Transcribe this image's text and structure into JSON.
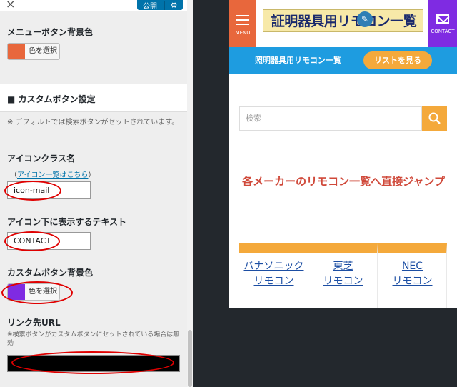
{
  "customizer": {
    "close_label": "×",
    "publish_label": "公開",
    "publish_gear": "⚙",
    "menu_bg_label": "メニューボタン背景色",
    "menu_bg_button": "色を選択",
    "menu_bg_color": "#e8673c",
    "section_title": "■ カスタムボタン設定",
    "section_note": "※ デフォルトでは検索ボタンがセットされています。",
    "icon_class_label": "アイコンクラス名",
    "icon_list_link": "アイコン一覧はこちら",
    "icon_class_value": "icon-mail",
    "icon_text_label": "アイコン下に表示するテキスト",
    "icon_text_value": "CONTACT",
    "custom_bg_label": "カスタムボタン背景色",
    "custom_bg_button": "色を選択",
    "custom_bg_color": "#7f2be2",
    "link_url_label": "リンク先URL",
    "link_url_note": "※検索ボタンがカスタムボタンにセットされている場合は無効"
  },
  "preview": {
    "menu_text": "MENU",
    "logo_text": "証明器具用リモコン一覧",
    "logo_icon": "pencil-icon",
    "contact_text": "CONTACT",
    "notice_text": "照明器具用リモコン一覧",
    "notice_button": "リストを見る",
    "search_placeholder": "検索",
    "jump_heading": "各メーカーのリモコン一覧へ直接ジャンプ",
    "makers": [
      {
        "name": "パナソニック",
        "suffix": "リモコン"
      },
      {
        "name": "東芝",
        "suffix": "リモコン"
      },
      {
        "name": "NEC",
        "suffix": "リモコン"
      }
    ],
    "colors": {
      "accent_orange": "#f4a93b",
      "notice_blue": "#1e9ce0",
      "heading_red": "#d0493a"
    }
  }
}
